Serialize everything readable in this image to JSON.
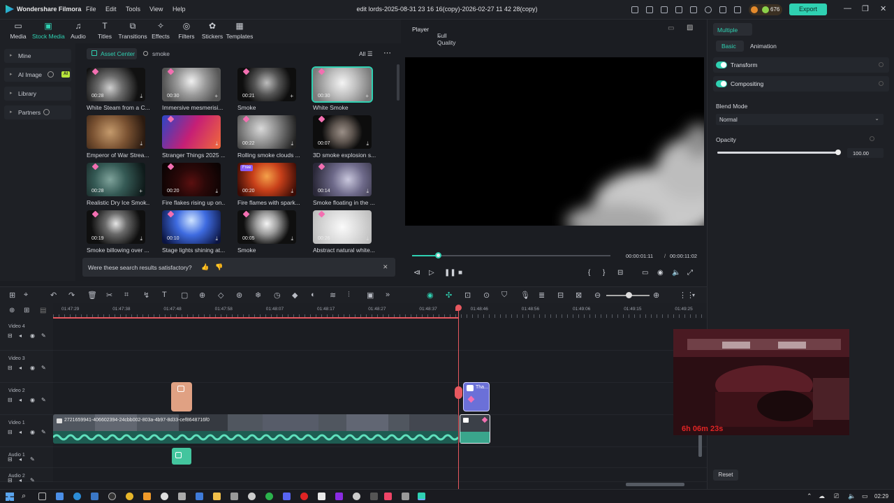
{
  "titlebar": {
    "app_name": "Wondershare Filmora",
    "menu": [
      "File",
      "Edit",
      "Tools",
      "View",
      "Help"
    ],
    "document": "edit lords-2025-08-31 23 16 16(copy)-2026-02-27 11 42 28(copy)",
    "coins": "676",
    "export_label": "Export"
  },
  "toolbar": {
    "items": [
      {
        "label": "Media",
        "icon": "media-icon"
      },
      {
        "label": "Stock Media",
        "icon": "stock-media-icon"
      },
      {
        "label": "Audio",
        "icon": "audio-icon"
      },
      {
        "label": "Titles",
        "icon": "titles-icon"
      },
      {
        "label": "Transitions",
        "icon": "transitions-icon"
      },
      {
        "label": "Effects",
        "icon": "effects-icon"
      },
      {
        "label": "Filters",
        "icon": "filters-icon"
      },
      {
        "label": "Stickers",
        "icon": "stickers-icon"
      },
      {
        "label": "Templates",
        "icon": "templates-icon"
      }
    ],
    "active": "Stock Media"
  },
  "sidebar": {
    "items": [
      {
        "label": "Mine"
      },
      {
        "label": "AI Image",
        "badge": "AI"
      },
      {
        "label": "Library"
      },
      {
        "label": "Partners"
      }
    ]
  },
  "media": {
    "asset_center": "Asset Center",
    "search_query": "smoke",
    "filter": "All",
    "cards": [
      {
        "caption": "White Steam from a C...",
        "duration": "00:28"
      },
      {
        "caption": "Immersive mesmerisi...",
        "duration": "00:30"
      },
      {
        "caption": "Smoke",
        "duration": "00:21"
      },
      {
        "caption": "White Smoke",
        "duration": "00:30"
      },
      {
        "caption": "Emperor of War Strea...",
        "duration": ""
      },
      {
        "caption": "Stranger Things 2025 ...",
        "duration": ""
      },
      {
        "caption": "Rolling smoke clouds ...",
        "duration": "00:22"
      },
      {
        "caption": "3D smoke explosion s...",
        "duration": "00:07"
      },
      {
        "caption": "Realistic Dry Ice Smok...",
        "duration": "00:28"
      },
      {
        "caption": "Fire flakes rising up on...",
        "duration": "00:20"
      },
      {
        "caption": "Fire flames with spark...",
        "duration": "00:20",
        "badge": "Free"
      },
      {
        "caption": "Smoke floating in the ...",
        "duration": "00:14"
      },
      {
        "caption": "Smoke billowing over ...",
        "duration": "00:19"
      },
      {
        "caption": "Stage lights shining at...",
        "duration": "00:10"
      },
      {
        "caption": "Smoke",
        "duration": "00:05"
      },
      {
        "caption": "Abstract natural white...",
        "duration": "00:26"
      }
    ],
    "feedback_question": "Were these search results satisfactory?"
  },
  "player": {
    "label": "Player",
    "quality": "Full Quality",
    "current_time": "00:00:01:11",
    "separator": "/",
    "total_time": "00:00:11:02",
    "progress": 0.13
  },
  "inspector": {
    "header": "Multiple",
    "tabs": [
      "Basic",
      "Animation"
    ],
    "active_tab": "Basic",
    "transform": "Transform",
    "compositing": "Compositing",
    "blend_label": "Blend Mode",
    "blend_value": "Normal",
    "opacity_label": "Opacity",
    "opacity_value": "100.00",
    "opacity_fraction": 1.0,
    "reset": "Reset"
  },
  "timeline": {
    "ruler": [
      "01:47:29",
      "01:47:38",
      "01:47:48",
      "01:47:58",
      "01:48:07",
      "01:48:17",
      "01:48:27",
      "01:48:37",
      "01:48:46",
      "01:48:56",
      "01:49:06",
      "01:49:15",
      "01:49:25"
    ],
    "tracks": [
      "Video 4",
      "Video 3",
      "Video 2",
      "Video 1",
      "Audio 1",
      "Audio 2"
    ],
    "main_clip_name": "2721659941-406602394-24cbb002-803a-4b97-8d33-cef8648716f0",
    "title_clip_name": "Tha..."
  },
  "webcam": {
    "timer": "6h 06m 23s"
  },
  "taskbar": {
    "time": "02:29"
  },
  "colors": {
    "accent": "#2fd1b2",
    "playhead": "#e7585f",
    "pink": "#f36fb1"
  }
}
